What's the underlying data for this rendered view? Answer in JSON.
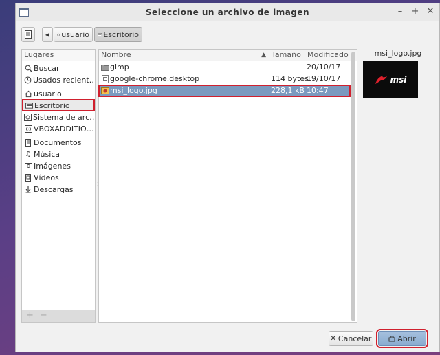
{
  "window": {
    "title": "Seleccione un archivo de imagen"
  },
  "breadcrumb": {
    "items": [
      "usuario",
      "Escritorio"
    ]
  },
  "places": {
    "header": "Lugares",
    "items": [
      {
        "label": "Buscar",
        "icon": "search-icon"
      },
      {
        "label": "Usados recient…",
        "icon": "recent-icon"
      },
      {
        "label": "usuario",
        "icon": "home-icon"
      },
      {
        "label": "Escritorio",
        "icon": "desktop-icon"
      },
      {
        "label": "Sistema de arc…",
        "icon": "drive-icon"
      },
      {
        "label": "VBOXADDITIO…",
        "icon": "disc-icon"
      },
      {
        "label": "Documentos",
        "icon": "document-icon"
      },
      {
        "label": "Música",
        "icon": "music-icon"
      },
      {
        "label": "Imágenes",
        "icon": "image-icon"
      },
      {
        "label": "Vídeos",
        "icon": "video-icon"
      },
      {
        "label": "Descargas",
        "icon": "download-icon"
      }
    ],
    "add": "+",
    "remove": "−"
  },
  "columns": {
    "name": "Nombre",
    "size": "Tamaño",
    "modified": "Modificado"
  },
  "files": [
    {
      "name": "gimp",
      "size": "",
      "modified": "20/10/17",
      "icon": "folder-icon"
    },
    {
      "name": "google-chrome.desktop",
      "size": "114 bytes",
      "modified": "19/10/17",
      "icon": "desktop-file-icon"
    },
    {
      "name": "msi_logo.jpg",
      "size": "228,1 kB",
      "modified": "10:47",
      "icon": "image-file-icon"
    }
  ],
  "preview": {
    "filename": "msi_logo.jpg",
    "logo_text": "msi"
  },
  "buttons": {
    "cancel": "Cancelar",
    "open": "Abrir"
  },
  "colors": {
    "selection": "#7b9abf",
    "highlight": "#d0202e"
  }
}
